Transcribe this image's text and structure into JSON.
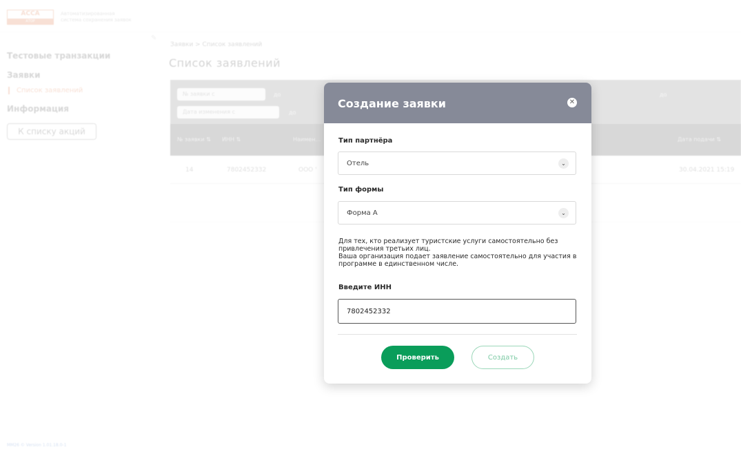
{
  "header": {
    "logo_title": "АССА",
    "logo_sub": "АТОР",
    "logo_caption": "Автоматизированная система сохранения заявок"
  },
  "sidebar": {
    "items": [
      {
        "label": "Тестовые транзакции"
      },
      {
        "label": "Заявки"
      },
      {
        "label": "Список заявлений"
      },
      {
        "label": "Информация"
      }
    ],
    "button_label": "К списку акций",
    "version": "MM26  © Version 1.01.18.0-1"
  },
  "main": {
    "breadcrumb": "Заявки  >  Список заявлений",
    "title": "Список заявлений",
    "filters": {
      "num_from": "№ заявки с",
      "num_to": "до",
      "date_from": "Дата изменения с",
      "date_to": "до",
      "right_to": "до"
    },
    "table": {
      "headers": [
        "№ заявки ⇅",
        "ИНН ⇅",
        "Наимен…",
        "Дата подачи ⇅"
      ],
      "rows": [
        {
          "num": "14",
          "inn": "7802452332",
          "name": "ООО '",
          "date": "30.04.2021 15:19"
        }
      ]
    }
  },
  "modal": {
    "title": "Создание заявки",
    "partner_type_label": "Тип партнёра",
    "partner_type_value": "Отель",
    "form_type_label": "Тип формы",
    "form_type_value": "Форма А",
    "description": "Для тех, кто реализует туристские услуги самостоятельно без привлечения третьих лиц.\nВаша организация подает заявление самостоятельно для участия в программе в единственном числе.",
    "inn_label": "Введите ИНН",
    "inn_value": "7802452332",
    "check_button": "Проверить",
    "create_button": "Создать"
  },
  "colors": {
    "accent_green": "#0a9d5a",
    "modal_header": "#868a98",
    "logo_orange": "#e07a4a"
  },
  "icons": {
    "close": "close-icon",
    "chevron": "chevron-down-icon"
  }
}
